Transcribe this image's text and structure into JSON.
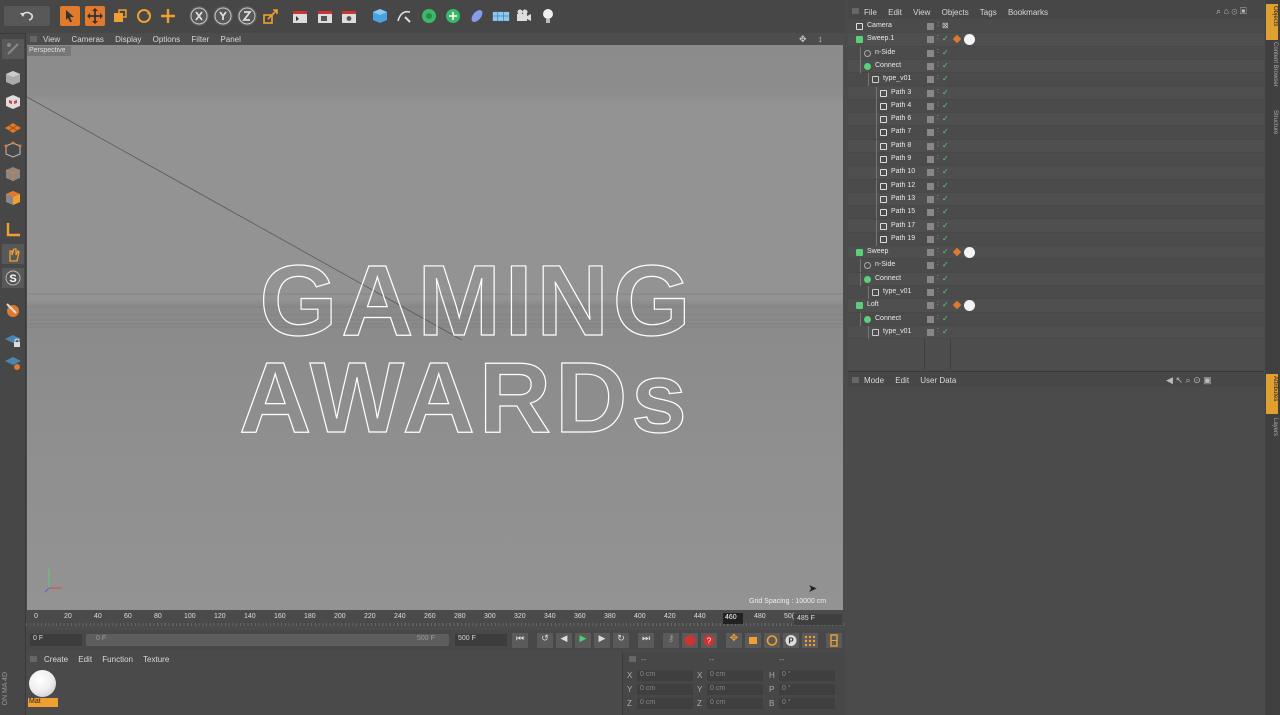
{
  "viewport": {
    "menu": [
      "View",
      "Cameras",
      "Display",
      "Options",
      "Filter",
      "Panel"
    ],
    "label": "Perspective",
    "grid_spacing": "Grid Spacing : 10000 cm",
    "text_line1": "GAMING",
    "text_line2": "AWARDs"
  },
  "timeline": {
    "ticks": [
      "0",
      "20",
      "40",
      "60",
      "80",
      "100",
      "120",
      "140",
      "160",
      "180",
      "200",
      "220",
      "240",
      "260",
      "280",
      "300",
      "320",
      "340",
      "360",
      "380",
      "400",
      "420",
      "440",
      "460",
      "480",
      "50("
    ],
    "current_frame_label": "460",
    "end_frame": "485 F"
  },
  "transport": {
    "start_frame": "0 F",
    "slider_left": "0 F",
    "slider_right": "500 F",
    "end_field": "500 F"
  },
  "material_manager": {
    "menu": [
      "Create",
      "Edit",
      "Function",
      "Texture"
    ],
    "material_name": "Mat"
  },
  "coordinates": {
    "headers": [
      "--",
      "--",
      "--"
    ],
    "rows": [
      {
        "a": "X",
        "av": "0 cm",
        "b": "X",
        "bv": "0 cm",
        "c": "H",
        "cv": "0 °"
      },
      {
        "a": "Y",
        "av": "0 cm",
        "b": "Y",
        "bv": "0 cm",
        "c": "P",
        "cv": "0 °"
      },
      {
        "a": "Z",
        "av": "0 cm",
        "b": "Z",
        "bv": "0 cm",
        "c": "B",
        "cv": "0 °"
      }
    ]
  },
  "object_manager": {
    "menu": [
      "File",
      "Edit",
      "View",
      "Objects",
      "Tags",
      "Bookmarks"
    ],
    "objects": [
      {
        "name": "Camera",
        "indent": 0,
        "icon": "camera-icon"
      },
      {
        "name": "Sweep.1",
        "indent": 0,
        "icon": "sweep-icon"
      },
      {
        "name": "n-Side",
        "indent": 1,
        "icon": "circle-icon"
      },
      {
        "name": "Connect",
        "indent": 1,
        "icon": "connect-icon"
      },
      {
        "name": "type_v01",
        "indent": 2,
        "icon": "group-icon"
      },
      {
        "name": "Path 3",
        "indent": 3,
        "icon": "spline-icon"
      },
      {
        "name": "Path 4",
        "indent": 3,
        "icon": "spline-icon"
      },
      {
        "name": "Path 6",
        "indent": 3,
        "icon": "spline-icon"
      },
      {
        "name": "Path 7",
        "indent": 3,
        "icon": "spline-icon"
      },
      {
        "name": "Path 8",
        "indent": 3,
        "icon": "spline-icon"
      },
      {
        "name": "Path 9",
        "indent": 3,
        "icon": "spline-icon"
      },
      {
        "name": "Path 10",
        "indent": 3,
        "icon": "spline-icon"
      },
      {
        "name": "Path 12",
        "indent": 3,
        "icon": "spline-icon"
      },
      {
        "name": "Path 13",
        "indent": 3,
        "icon": "spline-icon"
      },
      {
        "name": "Path 15",
        "indent": 3,
        "icon": "spline-icon"
      },
      {
        "name": "Path 17",
        "indent": 3,
        "icon": "spline-icon"
      },
      {
        "name": "Path 19",
        "indent": 3,
        "icon": "spline-icon"
      },
      {
        "name": "Sweep",
        "indent": 0,
        "icon": "sweep-icon"
      },
      {
        "name": "n-Side",
        "indent": 1,
        "icon": "circle-icon"
      },
      {
        "name": "Connect",
        "indent": 1,
        "icon": "connect-icon"
      },
      {
        "name": "type_v01",
        "indent": 2,
        "icon": "group-icon"
      },
      {
        "name": "Loft",
        "indent": 0,
        "icon": "loft-icon"
      },
      {
        "name": "Connect",
        "indent": 1,
        "icon": "connect-icon"
      },
      {
        "name": "type_v01",
        "indent": 2,
        "icon": "group-icon"
      }
    ]
  },
  "attribute_manager": {
    "menu": [
      "Mode",
      "Edit",
      "User Data"
    ]
  },
  "right_tabs_top": [
    "Objects",
    "Content Browser",
    "Structure"
  ],
  "right_tabs_bottom": [
    "Attributes",
    "Layers"
  ],
  "left_vertical_label": "ON MA 4D",
  "colors": {
    "accent": "#e8a33a",
    "highlight": "#f0a030",
    "green": "#5ad07a"
  }
}
